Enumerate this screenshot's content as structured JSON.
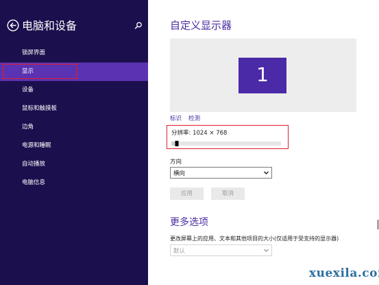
{
  "sidebar": {
    "title": "电脑和设备",
    "back_icon": "back-arrow-icon",
    "search_icon": "search-icon",
    "items": [
      {
        "label": "锁屏界面",
        "active": false
      },
      {
        "label": "显示",
        "active": true
      },
      {
        "label": "设备",
        "active": false
      },
      {
        "label": "鼠标和触摸板",
        "active": false
      },
      {
        "label": "边角",
        "active": false
      },
      {
        "label": "电源和睡眠",
        "active": false
      },
      {
        "label": "自动播放",
        "active": false
      },
      {
        "label": "电脑信息",
        "active": false
      }
    ]
  },
  "main": {
    "title": "自定义显示器",
    "monitor_label": "1",
    "identify_link": "标识",
    "detect_link": "检测",
    "resolution_label": "分辨率: 1024 × 768",
    "resolution_level": 0.05,
    "orientation_label": "方向",
    "orientation_value": "横向",
    "apply_button": "应用",
    "cancel_button": "取消",
    "more_options_title": "更多选项",
    "scale_label": "更改屏幕上的应用、文本和其他项目的大小(仅适用于受支持的显示器)",
    "scale_value": "默认"
  },
  "watermark": "xuexila.com",
  "colors": {
    "sidebar_bg": "#1c0f4d",
    "active_item": "#5b32b2",
    "accent": "#4b2da3",
    "highlight_box": "#e11d2a"
  }
}
